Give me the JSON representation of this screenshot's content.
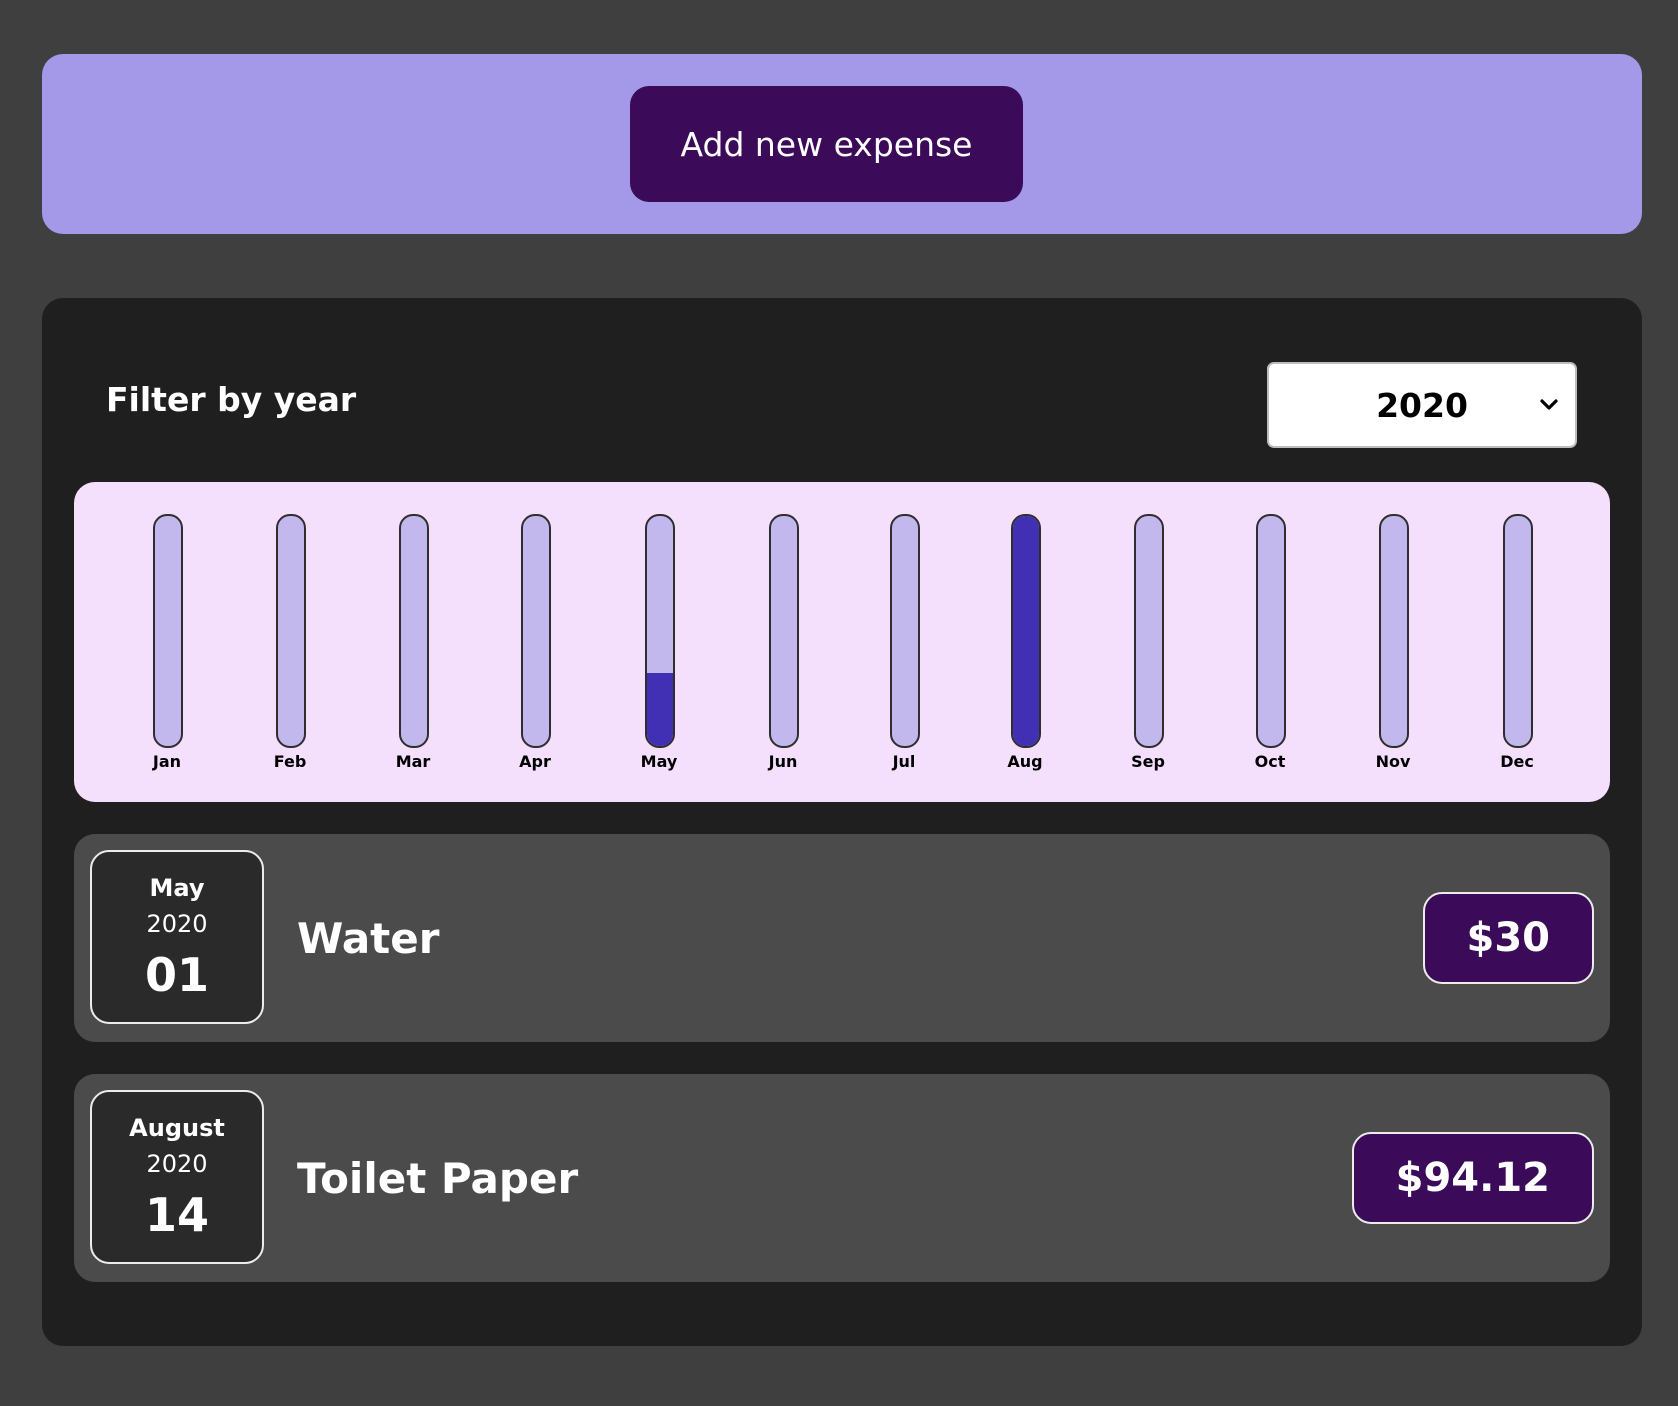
{
  "new_expense": {
    "add_button_label": "Add new expense"
  },
  "filter": {
    "label": "Filter by year",
    "selected_year": "2020",
    "dropdown_icon": "chevron-down-icon"
  },
  "chart_data": {
    "type": "bar",
    "categories": [
      "Jan",
      "Feb",
      "Mar",
      "Apr",
      "May",
      "Jun",
      "Jul",
      "Aug",
      "Sep",
      "Oct",
      "Nov",
      "Dec"
    ],
    "values": [
      0,
      0,
      0,
      0,
      30,
      0,
      0,
      94.12,
      0,
      0,
      0,
      0
    ],
    "ylim": [
      0,
      94.12
    ],
    "colors": {
      "track": "#c2b8ee",
      "fill": "#4230b4",
      "background": "#f4dffd"
    }
  },
  "expenses": [
    {
      "month": "May",
      "year": "2020",
      "day": "01",
      "title": "Water",
      "amount": "$30"
    },
    {
      "month": "August",
      "year": "2020",
      "day": "14",
      "title": "Toilet Paper",
      "amount": "$94.12"
    }
  ],
  "colors": {
    "page_bg": "#3f3f3f",
    "new_expense_bg": "#a399e8",
    "accent_dark": "#3b0b59",
    "panel_bg": "#1f1f1f",
    "item_bg": "#4b4b4b"
  }
}
